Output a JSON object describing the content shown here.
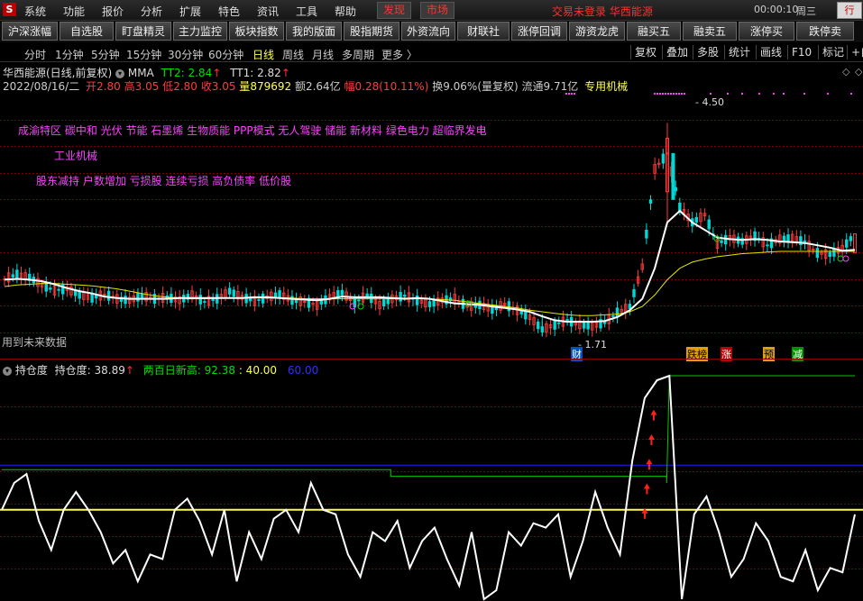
{
  "menu": {
    "logo": "S",
    "items": [
      "系统",
      "功能",
      "报价",
      "分析",
      "扩展",
      "特色",
      "资讯",
      "工具",
      "帮助"
    ],
    "tabs": [
      "发现",
      "市场"
    ],
    "status": "交易未登录  华西能源",
    "clock": "00:00:10",
    "weekday": "周三",
    "corner": "行"
  },
  "toolbar": [
    "沪深涨幅",
    "自选股",
    "盯盘精灵",
    "主力监控",
    "板块指数",
    "我的版面",
    "股指期货",
    "外资流向",
    "财联社",
    "涨停回调",
    "游资龙虎",
    "融买五",
    "融卖五",
    "涨停买",
    "跌停卖"
  ],
  "periods": {
    "items": [
      "分时",
      "1分钟",
      "5分钟",
      "15分钟",
      "30分钟",
      "60分钟",
      "日线",
      "周线",
      "月线",
      "多周期",
      "更多 〉"
    ],
    "active": "日线",
    "right": [
      "复权",
      "叠加",
      "多股",
      "统计",
      "画线",
      "F10",
      "标记",
      "+自"
    ]
  },
  "chart_header": {
    "stock": "华西能源(日线,前复权)",
    "indicator": "MMA",
    "tt2_label": "TT2: 2.84",
    "tt1_label": "TT1: 2.82",
    "date": "2022/08/16/二",
    "open_label": "开",
    "open": "2.80",
    "high_label": "高",
    "high": "3.05",
    "low_label": "低",
    "low": "2.80",
    "close_label": "收",
    "close": "3.05",
    "vol_label": "量",
    "vol": "879692",
    "amount": "额2.64亿",
    "chg_label": "幅",
    "chg": "0.28(10.11%)",
    "turnover": "换9.06%(量复权)",
    "float": "流通9.71亿",
    "special": "专用机械"
  },
  "concepts": {
    "line1": "成渝特区 碳中和 光伏 节能 石墨烯 生物质能 PPP模式 无人驾驶 储能 新材料 绿色电力 超临界发电",
    "line2": "工业机械",
    "line3": "股东减持 户数增加 亏损股 连续亏损 高负债率 低价股"
  },
  "annotations": {
    "high": "4.50",
    "low": "1.71",
    "future_warn": "用到未来数据",
    "cai": "财",
    "marks": [
      "跌榜",
      "涨",
      "预",
      "减"
    ]
  },
  "sub_header": {
    "name": "持仓度",
    "value_label": "持仓度: 38.89",
    "new_high_label": "两百日新高: 92.38",
    "level1": ": 40.00",
    "level2": "60.00"
  },
  "colors": {
    "up": "#ff3c3c",
    "down": "#00d8d8",
    "ma_white": "#ffffff",
    "ma_yellow": "#e6e600",
    "grid": "#7a0000",
    "concept": "#ff40ff",
    "green": "#00c800",
    "blue": "#2020ff",
    "magenta": "#ff40ff"
  },
  "chart_data": {
    "type": "line",
    "main": {
      "series_names": [
        "MMA",
        "TT2",
        "TT1"
      ],
      "ma_white": [
        2.45,
        2.46,
        2.45,
        2.43,
        2.39,
        2.34,
        2.3,
        2.27,
        2.23,
        2.21,
        2.2,
        2.2,
        2.2,
        2.2,
        2.21,
        2.21,
        2.21,
        2.21,
        2.21,
        2.21,
        2.22,
        2.22,
        2.21,
        2.2,
        2.19,
        2.18,
        2.2,
        2.23,
        2.22,
        2.22,
        2.22,
        2.21,
        2.2,
        2.21,
        2.2,
        2.17,
        2.14,
        2.13,
        2.12,
        2.1,
        2.08,
        2.06,
        2.03,
        1.97,
        1.92,
        1.9,
        1.9,
        1.9,
        1.91,
        1.96,
        2.05,
        2.2,
        2.6,
        3.2,
        3.35,
        3.2,
        3.1,
        3.0,
        2.98,
        2.97,
        2.98,
        2.97,
        2.95,
        2.94,
        2.93,
        2.9,
        2.87,
        2.83,
        2.84
      ],
      "ma_yellow": [
        2.36,
        2.38,
        2.39,
        2.4,
        2.4,
        2.39,
        2.38,
        2.37,
        2.35,
        2.33,
        2.3,
        2.27,
        2.24,
        2.22,
        2.21,
        2.2,
        2.2,
        2.21,
        2.21,
        2.21,
        2.21,
        2.21,
        2.21,
        2.21,
        2.2,
        2.2,
        2.2,
        2.2,
        2.2,
        2.2,
        2.2,
        2.2,
        2.21,
        2.2,
        2.2,
        2.19,
        2.18,
        2.16,
        2.14,
        2.12,
        2.1,
        2.08,
        2.05,
        2.03,
        2.01,
        1.99,
        1.98,
        1.98,
        1.99,
        2.0,
        2.03,
        2.1,
        2.25,
        2.45,
        2.6,
        2.68,
        2.72,
        2.75,
        2.77,
        2.79,
        2.8,
        2.81,
        2.82,
        2.82,
        2.82,
        2.82,
        2.82,
        2.82,
        2.82
      ],
      "candle_close": [
        2.46,
        2.52,
        2.48,
        2.38,
        2.31,
        2.33,
        2.25,
        2.21,
        2.26,
        2.2,
        2.18,
        2.24,
        2.2,
        2.22,
        2.18,
        2.25,
        2.16,
        2.2,
        2.3,
        2.22,
        2.17,
        2.22,
        2.26,
        2.18,
        2.16,
        2.12,
        2.22,
        2.28,
        2.15,
        2.25,
        2.12,
        2.2,
        2.24,
        2.18,
        2.13,
        2.18,
        2.2,
        2.1,
        2.12,
        2.06,
        2.13,
        2.05,
        1.96,
        1.8,
        1.86,
        1.92,
        1.86,
        1.84,
        1.89,
        2.02,
        2.1,
        2.62,
        3.9,
        4.1,
        3.4,
        3.2,
        3.3,
        2.92,
        3.0,
        2.95,
        3.02,
        2.9,
        2.98,
        3.0,
        2.94,
        2.8,
        2.78,
        2.86,
        3.05
      ],
      "high_mark": 4.5,
      "low_mark": 1.71,
      "last": {
        "open": 2.8,
        "high": 3.05,
        "low": 2.8,
        "close": 3.05
      }
    },
    "sub": {
      "series_names": [
        "持仓度",
        "两百日新高"
      ],
      "ylim": [
        0,
        100
      ],
      "hold": [
        40,
        52,
        56,
        35,
        22,
        40,
        48,
        40,
        30,
        16,
        22,
        8,
        20,
        18,
        40,
        45,
        35,
        20,
        40,
        8,
        30,
        18,
        36,
        40,
        30,
        52,
        40,
        38,
        20,
        10,
        30,
        26,
        35,
        14,
        26,
        32,
        18,
        6,
        30,
        0,
        4,
        30,
        24,
        34,
        32,
        38,
        10,
        26,
        48,
        32,
        20,
        62,
        90,
        98,
        100,
        0,
        38,
        46,
        30,
        10,
        18,
        34,
        26,
        10,
        8,
        22,
        4,
        14,
        12,
        38
      ],
      "new_high": [
        58,
        58,
        58,
        58,
        58,
        58,
        58,
        58,
        58,
        58,
        58,
        58,
        58,
        58,
        58,
        58,
        58,
        58,
        58,
        58,
        58,
        58,
        58,
        58,
        58,
        58,
        58,
        58,
        58,
        58,
        58,
        55,
        55,
        55,
        55,
        55,
        55,
        55,
        55,
        55,
        55,
        55,
        55,
        55,
        55,
        55,
        55,
        55,
        55,
        55,
        55,
        55,
        55,
        52,
        52,
        52,
        52,
        52,
        52,
        52,
        52,
        52,
        52,
        52,
        52,
        52,
        52,
        52,
        52
      ],
      "levels": [
        40,
        60
      ]
    }
  }
}
